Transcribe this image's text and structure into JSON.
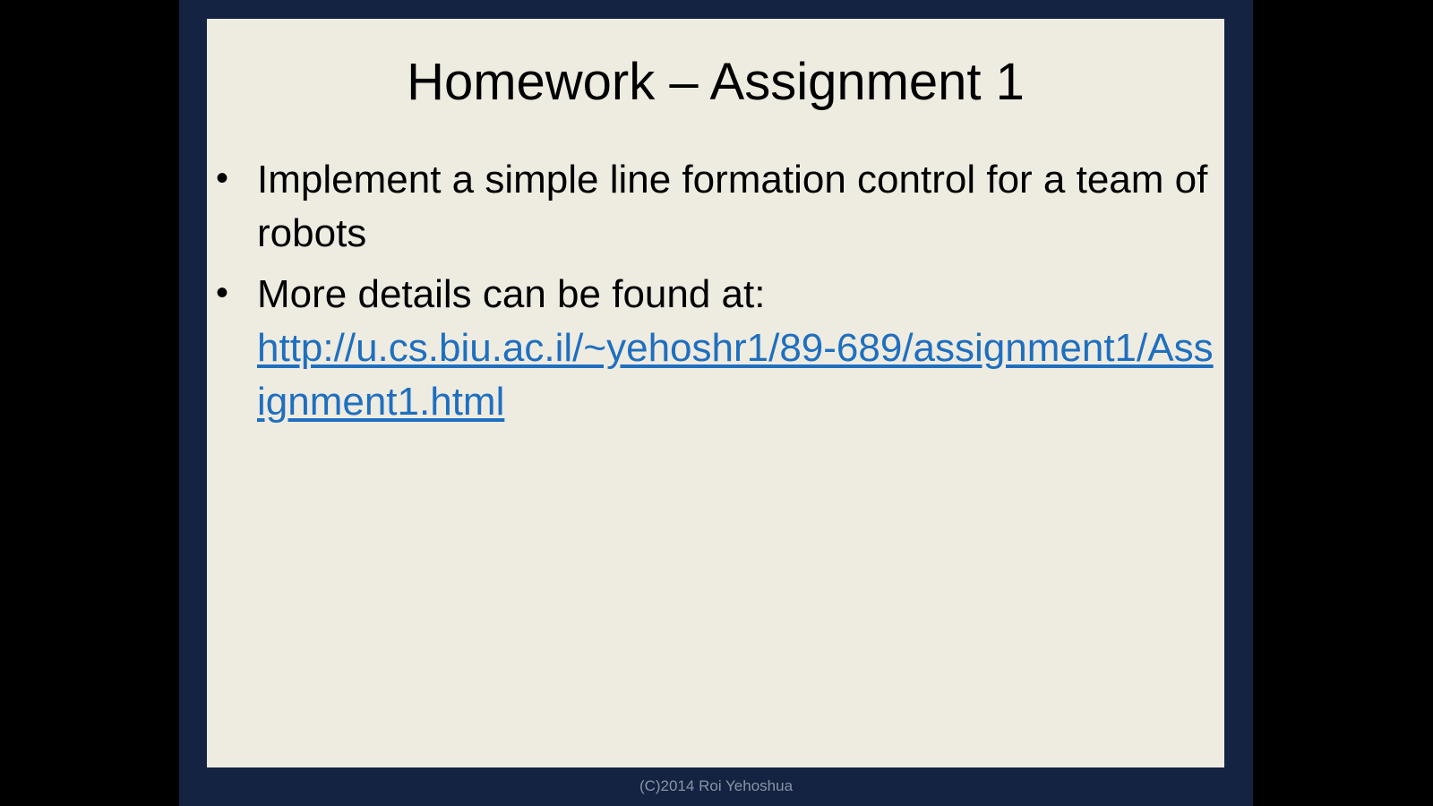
{
  "slide": {
    "title": "Homework – Assignment 1",
    "bullets": [
      {
        "text": "Implement a simple line formation control for a team of robots"
      },
      {
        "text": "More details can be found at:",
        "link": "http://u.cs.biu.ac.il/~yehoshr1/89-689/assignment1/Assignment1.html"
      }
    ],
    "footer": "(C)2014 Roi Yehoshua"
  },
  "colors": {
    "frame": "#132341",
    "content_bg": "#eeebe1",
    "link": "#1f6fbf",
    "footer_text": "#8a93a6"
  }
}
